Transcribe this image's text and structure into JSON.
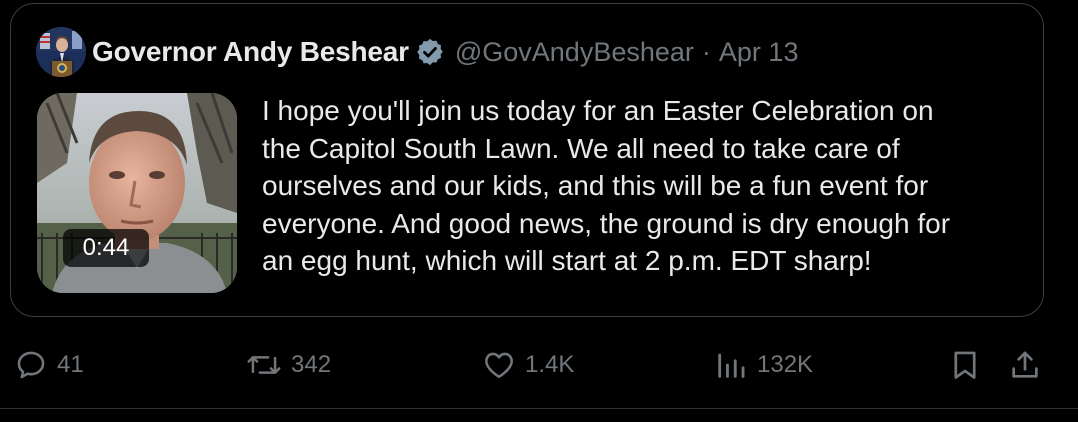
{
  "quoted_tweet": {
    "author": {
      "display_name": "Governor Andy Beshear",
      "handle": "@GovAndyBeshear",
      "verified": true,
      "avatar_icon": "governor-portrait"
    },
    "separator": "·",
    "date": "Apr 13",
    "media": {
      "type": "video",
      "duration": "0:44",
      "thumbnail_icon": "video-thumbnail-selfie"
    },
    "text_lines": [
      "I hope you'll join us today for an Easter Celebration on",
      "the Capitol South Lawn. We all need to take care of",
      "ourselves and our kids, and this will be a fun event for",
      "everyone. And good news, the ground is dry enough for",
      "an egg hunt, which will start at 2 p.m. EDT sharp!"
    ]
  },
  "actions": {
    "reply": {
      "icon": "reply-icon",
      "count": "41"
    },
    "repost": {
      "icon": "repost-icon",
      "count": "342"
    },
    "like": {
      "icon": "heart-icon",
      "count": "1.4K"
    },
    "views": {
      "icon": "views-icon",
      "count": "132K"
    },
    "bookmark": {
      "icon": "bookmark-icon"
    },
    "share": {
      "icon": "share-icon"
    }
  },
  "colors": {
    "background": "#000000",
    "text_primary": "#e7e9ea",
    "text_secondary": "#71767b",
    "border": "#3a3d41",
    "verified_badge": "#829aab"
  }
}
